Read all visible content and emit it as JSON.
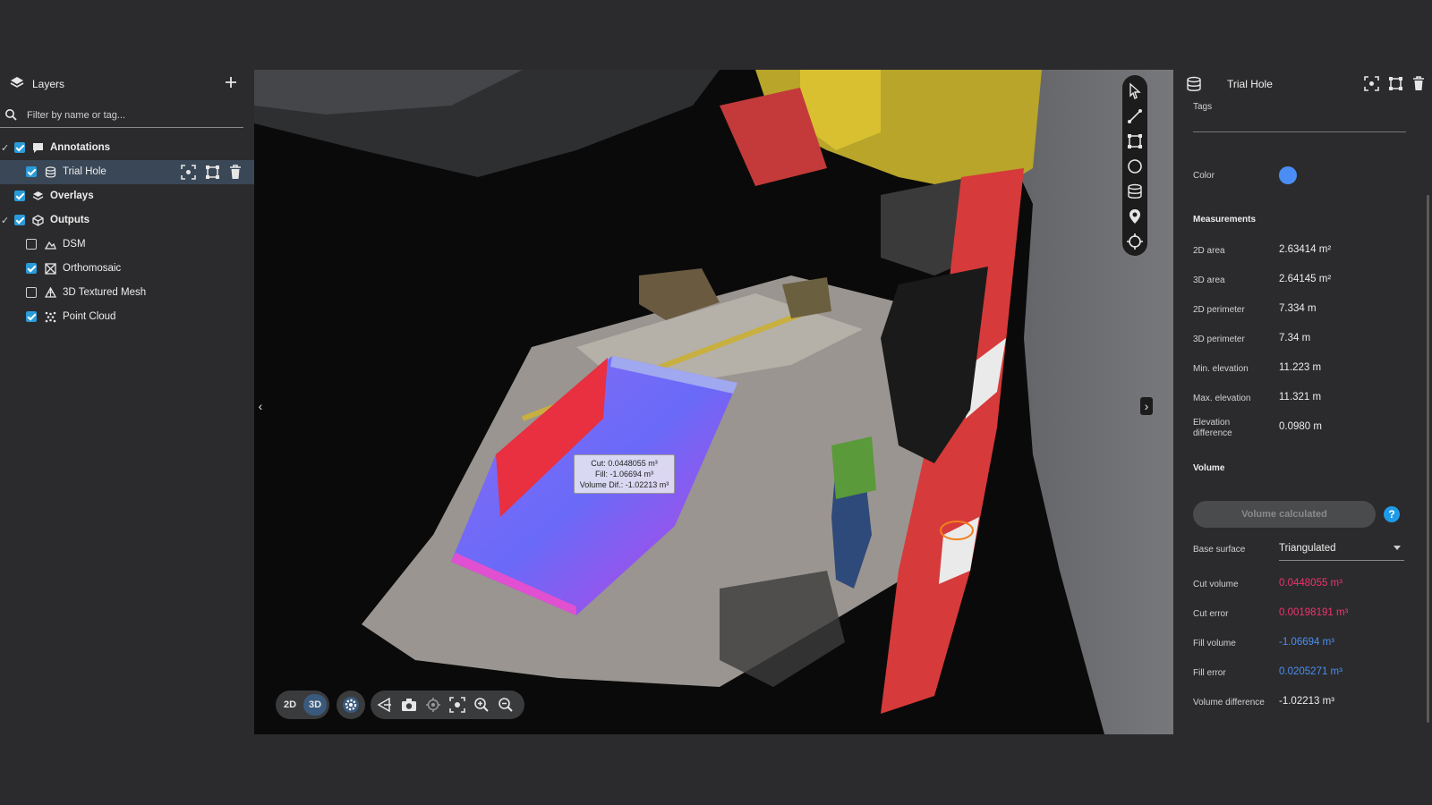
{
  "layers_panel": {
    "title": "Layers",
    "filter_placeholder": "Filter by name or tag...",
    "rows": [
      {
        "label": "Annotations",
        "checked": true
      },
      {
        "label": "Trial Hole",
        "checked": true
      },
      {
        "label": "Overlays",
        "checked": true
      },
      {
        "label": "Outputs",
        "checked": true
      },
      {
        "label": "DSM",
        "checked": false
      },
      {
        "label": "Orthomosaic",
        "checked": true
      },
      {
        "label": "3D Textured Mesh",
        "checked": false
      },
      {
        "label": "Point Cloud",
        "checked": true
      }
    ]
  },
  "viewport": {
    "tooltip": {
      "cut": "Cut: 0.0448055 m³",
      "fill": "Fill: -1.06694 m³",
      "diff": "Volume Dif.: -1.02213 m³"
    },
    "view_modes": [
      "2D",
      "3D"
    ],
    "active_view_mode": "3D"
  },
  "details_panel": {
    "title": "Trial Hole",
    "tags_label": "Tags",
    "color_label": "Color",
    "color_value": "#4a8ef5",
    "measurements_heading": "Measurements",
    "measurements": [
      {
        "label": "2D area",
        "value": "2.63414 m²"
      },
      {
        "label": "3D area",
        "value": "2.64145 m²"
      },
      {
        "label": "2D perimeter",
        "value": "7.334 m"
      },
      {
        "label": "3D perimeter",
        "value": "7.34 m"
      },
      {
        "label": "Min. elevation",
        "value": "11.223 m"
      },
      {
        "label": "Max. elevation",
        "value": "11.321 m"
      },
      {
        "label": "Elevation",
        "label2": "difference",
        "value": "0.0980 m"
      }
    ],
    "volume_heading": "Volume",
    "volume_button": "Volume calculated",
    "help_glyph": "?",
    "base_surface_label": "Base surface",
    "base_surface_value": "Triangulated",
    "volume": [
      {
        "label": "Cut volume",
        "value": "0.0448055 m³",
        "color": "red"
      },
      {
        "label": "Cut error",
        "value": "0.00198191 m³",
        "color": "red"
      },
      {
        "label": "Fill volume",
        "value": "-1.06694 m³",
        "color": "blue"
      },
      {
        "label": "Fill error",
        "value": "0.0205271 m³",
        "color": "blue"
      },
      {
        "label": "Volume difference",
        "value": "-1.02213 m³",
        "color": "default"
      }
    ]
  },
  "colors": {
    "accent": "#2a9bd8",
    "cut_red": "#f0336e",
    "fill_blue": "#4a8ff0",
    "selected_row": "#3a4757"
  }
}
